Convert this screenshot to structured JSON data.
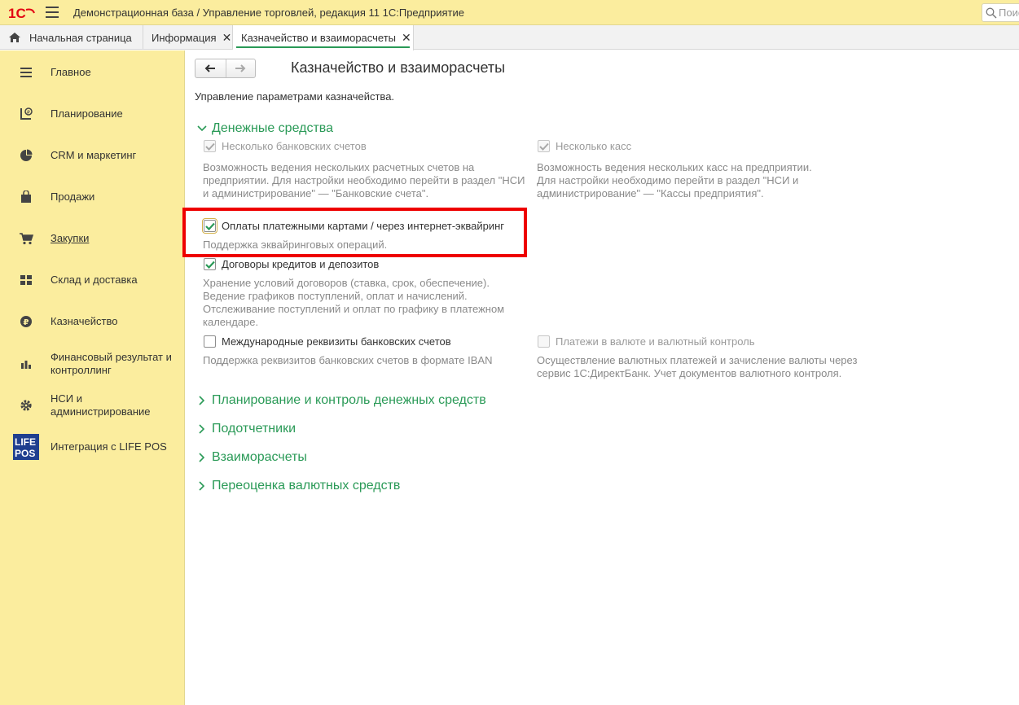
{
  "titlebar": {
    "logo_text": "1С",
    "title": "Демонстрационная база / Управление торговлей, редакция 11 1С:Предприятие",
    "search_placeholder": "Поиск"
  },
  "tabs": [
    {
      "label": "Начальная страница",
      "icon": "home-icon"
    },
    {
      "label": "Информация",
      "closable": true
    },
    {
      "label": "Казначейство и взаиморасчеты",
      "closable": true,
      "active": true
    }
  ],
  "sidebar": {
    "items": [
      {
        "label": "Главное",
        "icon": "menu-lines-icon"
      },
      {
        "label": "Планирование",
        "icon": "planning-icon"
      },
      {
        "label": "CRM и маркетинг",
        "icon": "pie-chart-icon"
      },
      {
        "label": "Продажи",
        "icon": "shopping-bag-icon"
      },
      {
        "label": "Закупки",
        "icon": "cart-icon",
        "underlined": true
      },
      {
        "label": "Склад и доставка",
        "icon": "warehouse-grid-icon"
      },
      {
        "label": "Казначейство",
        "icon": "ruble-coin-icon"
      },
      {
        "label": "Финансовый результат и контроллинг",
        "icon": "bar-chart-icon"
      },
      {
        "label": "НСИ и администрирование",
        "icon": "gear-icon"
      },
      {
        "label": "Интеграция с LIFE POS",
        "icon": "life-pos-logo",
        "logo_text": [
          "LIFE",
          "POS"
        ]
      }
    ]
  },
  "page": {
    "title": "Казначейство и взаиморасчеты",
    "description": "Управление параметрами казначейства.",
    "sections": {
      "money": "Денежные средства",
      "planning": "Планирование и контроль денежных средств",
      "accountables": "Подотчетники",
      "settlements": "Взаиморасчеты",
      "revaluation": "Переоценка валютных средств"
    },
    "options": {
      "multi_bank": {
        "label": "Несколько банковских счетов",
        "checked": true,
        "enabled": false,
        "desc": [
          "Возможность ведения нескольких расчетных счетов на",
          "предприятии. Для настройки необходимо перейти в раздел \"НСИ",
          "и администрирование\" — \"Банковские счета\"."
        ]
      },
      "multi_cash": {
        "label": "Несколько касс",
        "checked": true,
        "enabled": false,
        "desc": [
          "Возможность ведения нескольких касс на предприятии.",
          "Для настройки необходимо перейти в раздел \"НСИ и",
          "администрирование\" — \"Кассы предприятия\"."
        ]
      },
      "card_payments": {
        "label": "Оплаты платежными картами / через интернет-эквайринг",
        "checked": true,
        "enabled": true,
        "desc": [
          "Поддержка эквайринговых операций."
        ]
      },
      "loans": {
        "label": "Договоры кредитов и депозитов",
        "checked": true,
        "enabled": true,
        "desc": [
          "Хранение условий договоров (ставка, срок, обеспечение).",
          "Ведение графиков поступлений, оплат и начислений.",
          "Отслеживание поступлений и оплат по графику в платежном",
          "календаре."
        ]
      },
      "iban": {
        "label": "Международные реквизиты банковских счетов",
        "checked": false,
        "enabled": true,
        "desc": [
          "Поддержка реквизитов банковских счетов в формате IBAN"
        ]
      },
      "currency": {
        "label": "Платежи в валюте и валютный контроль",
        "checked": false,
        "enabled": false,
        "desc": [
          "Осуществление валютных платежей и зачисление валюты через",
          "сервис 1С:ДиректБанк. Учет документов валютного контроля."
        ]
      }
    }
  },
  "colors": {
    "panel_yellow": "#fbed9e",
    "accent_green": "#2a9a57",
    "highlight_red": "#ee0000",
    "logo_red": "#e30613"
  }
}
